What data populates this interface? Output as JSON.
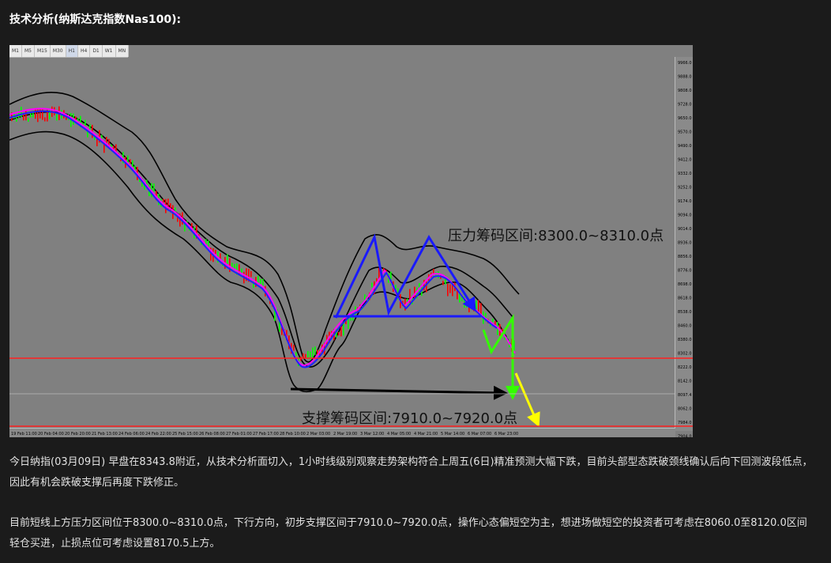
{
  "heading": "技术分析(纳斯达克指数Nas100):",
  "chart": {
    "timeframes": [
      "M1",
      "M5",
      "M15",
      "M30",
      "H1",
      "H4",
      "D1",
      "W1",
      "MN"
    ],
    "active_timeframe": "H1",
    "price_ticks": [
      "9966.0",
      "9888.0",
      "9808.0",
      "9728.0",
      "9650.0",
      "9570.0",
      "9490.0",
      "9412.0",
      "9332.0",
      "9252.0",
      "9174.0",
      "9094.0",
      "9014.0",
      "8936.0",
      "8856.0",
      "8776.0",
      "8698.0",
      "8618.0",
      "8538.0",
      "8460.0",
      "8380.0",
      "8302.0",
      "8222.0",
      "8142.0",
      "8097.4",
      "8062.0",
      "7984.0",
      "7904.0"
    ],
    "date_ticks": [
      "19 Feb 11:00",
      "20 Feb 04:00",
      "20 Feb 20:00",
      "21 Feb 13:00",
      "24 Feb 06:00",
      "24 Feb 22:00",
      "25 Feb 15:00",
      "26 Feb 08:00",
      "27 Feb 01:00",
      "27 Feb 17:00",
      "28 Feb 10:00",
      "2 Mar 03:00",
      "2 Mar 19:00",
      "3 Mar 12:00",
      "4 Mar 05:00",
      "4 Mar 21:00",
      "5 Mar 14:00",
      "6 Mar 07:00",
      "6 Mar 23:00"
    ],
    "resistance_label": "压力筹码区间:8300.0~8310.0点",
    "support_label": "支撑筹码区间:7910.0~7920.0点",
    "colors": {
      "background": "#808080",
      "bull_candle": "#00ff00",
      "bear_candle": "#ff0000",
      "moving_average": "#ff00ff",
      "fast_line": "#2020ff",
      "bands": "#000000",
      "pattern_arrows": "#1a1aff",
      "neckline": "#1a1aff",
      "breakdown_arrow": "#33ff00",
      "projection_arrow": "#ffff00",
      "price_lines": "#ff0000"
    }
  },
  "paragraphs": [
    "今日纳指(03月09日) 早盘在8343.8附近，从技术分析面切入，1小时线级别观察走势架构符合上周五(6日)精准预测大幅下跌，目前头部型态跌破颈线确认后向下回测波段低点，因此有机会跌破支撑后再度下跌修正。",
    "目前短线上方压力区间位于8300.0~8310.0点，下行方向，初步支撑区间于7910.0~7920.0点，操作心态偏短空为主，想进场做短空的投资者可考虑在8060.0至8120.0区间轻仓买进，止损点位可考虑设置8170.5上方。"
  ]
}
